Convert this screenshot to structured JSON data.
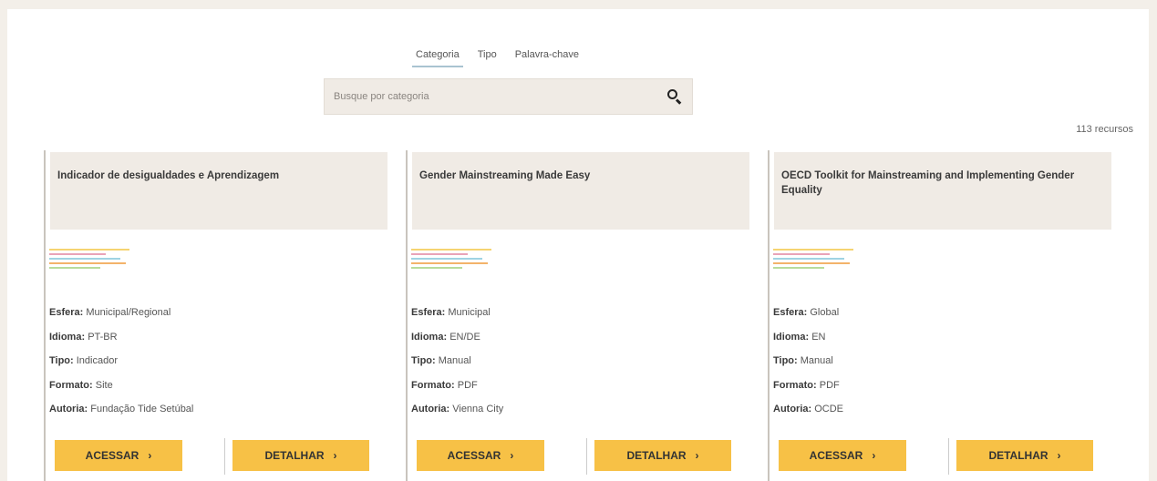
{
  "tabs": [
    {
      "label": "Categoria",
      "active": true
    },
    {
      "label": "Tipo",
      "active": false
    },
    {
      "label": "Palavra-chave",
      "active": false
    }
  ],
  "search": {
    "placeholder": "Busque por categoria",
    "icon": "search-icon"
  },
  "results_count": "113 recursos",
  "stripe_colors": [
    "#f5d472",
    "#e9a3b8",
    "#9fd3e3",
    "#f3b36a",
    "#b8dc9b"
  ],
  "accent_color": "#f7c146",
  "labels": {
    "esfera": "Esfera:",
    "idioma": "Idioma:",
    "tipo": "Tipo:",
    "formato": "Formato:",
    "autoria": "Autoria:"
  },
  "buttons": {
    "access": "ACESSAR",
    "detail": "DETALHAR",
    "chevron": "›"
  },
  "cards": [
    {
      "title": "Indicador de desigualdades e Aprendizagem",
      "esfera": "Municipal/Regional",
      "idioma": "PT-BR",
      "tipo": "Indicador",
      "formato": "Site",
      "autoria": "Fundação Tide Setúbal"
    },
    {
      "title": "Gender Mainstreaming Made Easy",
      "esfera": "Municipal",
      "idioma": "EN/DE",
      "tipo": "Manual",
      "formato": "PDF",
      "autoria": "Vienna City"
    },
    {
      "title": "OECD Toolkit for Mainstreaming and Implementing Gender Equality",
      "esfera": "Global",
      "idioma": "EN",
      "tipo": "Manual",
      "formato": "PDF",
      "autoria": "OCDE"
    }
  ]
}
